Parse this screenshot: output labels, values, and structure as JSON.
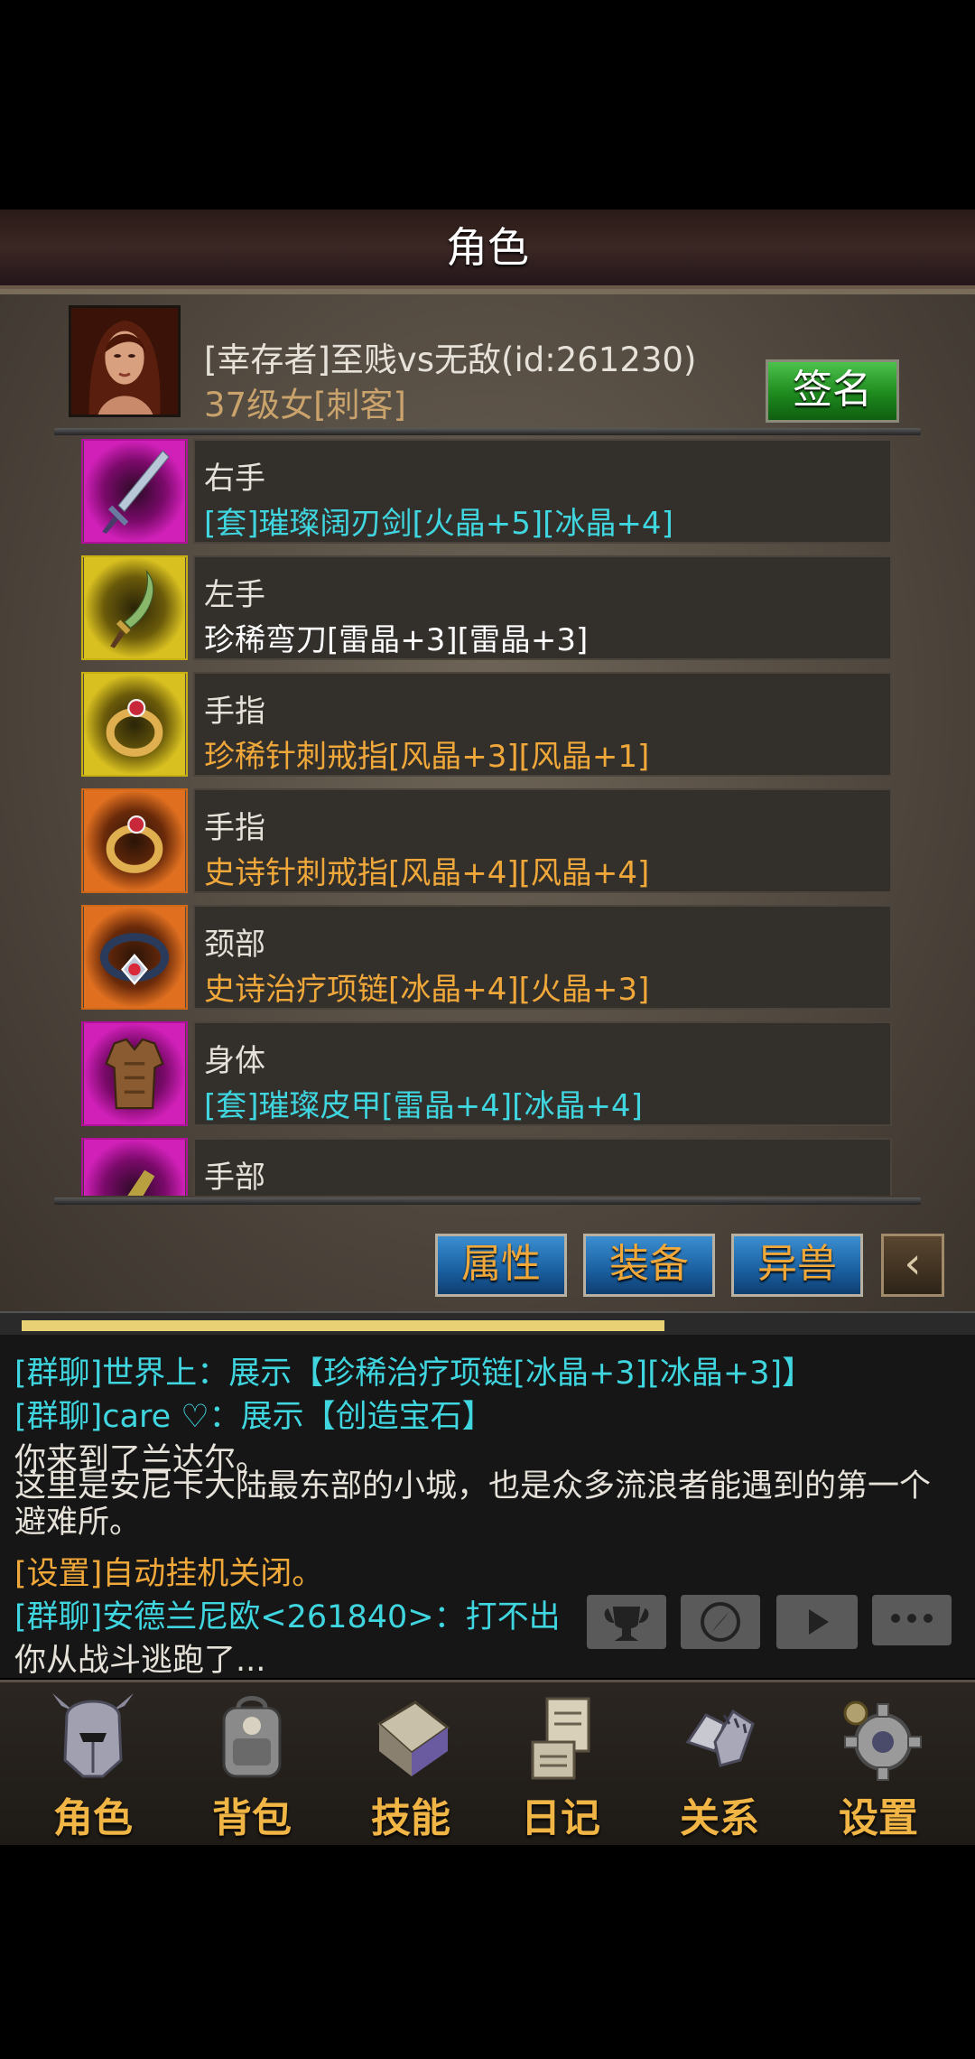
{
  "header": {
    "title": "角色"
  },
  "profile": {
    "name": "[幸存者]至贱vs无敌(id:261230)",
    "info": "37级女[刺客]",
    "sign_label": "签名"
  },
  "equipment": [
    {
      "slot": "右手",
      "item": "[套]璀璨阔刃剑[火晶+5][冰晶+4]",
      "item_color": "#3fd6e0",
      "icon": "sword-icon",
      "frame_color": "#b0109a"
    },
    {
      "slot": "左手",
      "item": "珍稀弯刀[雷晶+3][雷晶+3]",
      "item_color": "#ffffff",
      "icon": "scimitar-icon",
      "frame_color": "#c8b012"
    },
    {
      "slot": "手指",
      "item": "珍稀针刺戒指[风晶+3][风晶+1]",
      "item_color": "#f0a83a",
      "icon": "ring-icon",
      "frame_color": "#c8b012"
    },
    {
      "slot": "手指",
      "item": "史诗针刺戒指[风晶+4][风晶+4]",
      "item_color": "#f0a83a",
      "icon": "ring-icon",
      "frame_color": "#d0681a"
    },
    {
      "slot": "颈部",
      "item": "史诗治疗项链[冰晶+4][火晶+3]",
      "item_color": "#f0a83a",
      "icon": "necklace-icon",
      "frame_color": "#d0681a"
    },
    {
      "slot": "身体",
      "item": "[套]璀璨皮甲[雷晶+4][冰晶+4]",
      "item_color": "#3fd6e0",
      "icon": "armor-icon",
      "frame_color": "#b0109a"
    },
    {
      "slot": "手部",
      "item": "",
      "item_color": "#3fd6e0",
      "icon": "glove-icon",
      "frame_color": "#b0109a"
    }
  ],
  "tabs": {
    "attributes": "属性",
    "equipment": "装备",
    "beast": "异兽"
  },
  "experience": {
    "progress": 0.69
  },
  "chat": [
    {
      "text": "[群聊]世界上：展示【珍稀治疗项链[冰晶+3][冰晶+3]】",
      "color": "#3fd6e0"
    },
    {
      "text": "[群聊]care ♡：展示【创造宝石】",
      "color": "#3fd6e0"
    },
    {
      "text": "你来到了兰达尔。",
      "color": "#e6e2da"
    },
    {
      "text": "这里是安尼卡大陆最东部的小城，也是众多流浪者能遇到的第一个避难所。",
      "color": "#e6e2da"
    },
    {
      "text": "[设置]自动挂机关闭。",
      "color": "#f0a83a"
    },
    {
      "text": "[群聊]安德兰尼欧<261840>：打不出",
      "color": "#3fd6e0"
    },
    {
      "text": "你从战斗逃跑了...",
      "color": "#e6e2da"
    }
  ],
  "nav": [
    {
      "label": "角色",
      "icon": "helmet-icon"
    },
    {
      "label": "背包",
      "icon": "backpack-icon"
    },
    {
      "label": "技能",
      "icon": "skill-book-icon"
    },
    {
      "label": "日记",
      "icon": "scroll-icon"
    },
    {
      "label": "关系",
      "icon": "gauntlet-icon"
    },
    {
      "label": "设置",
      "icon": "gear-icon"
    }
  ]
}
